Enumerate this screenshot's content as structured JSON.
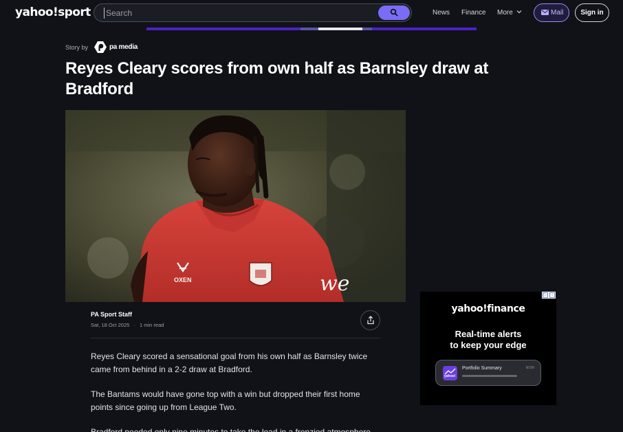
{
  "header": {
    "logo": "yahoo!sport",
    "search_placeholder": "Search",
    "nav": [
      "News",
      "Finance",
      "More"
    ],
    "mail_label": "Mail",
    "signin_label": "Sign in"
  },
  "article": {
    "story_by": "Story by",
    "publisher": "pa media",
    "headline": "Reyes Cleary scores from own half as Barnsley draw at Bradford",
    "author": "PA Sport Staff",
    "date": "Sat, 18 Oct 2025",
    "read_time": "1 min read",
    "paragraphs": [
      "Reyes Cleary scored a sensational goal from his own half as Barnsley twice came from behind in a 2-2 draw at Bradford.",
      "The Bantams would have gone top with a win but dropped their first home points since going up from League Two.",
      "Bradford needed only nine minutes to take the lead in a frenzied atmosphere"
    ]
  },
  "ad": {
    "logo": "yahoo!finance",
    "headline_line1": "Real-time alerts",
    "headline_line2": "to keep your edge",
    "card_title": "Portfolio Summary",
    "card_now": "NOW",
    "card_icon_text": "yahoo!"
  },
  "hero_shirt": {
    "sponsor": "OXEN",
    "script": "we"
  },
  "icons": [
    "search-icon",
    "chevron-down-icon",
    "mail-icon",
    "share-icon",
    "ad-choices-icon"
  ],
  "colors": {
    "accent": "#7b6cf6",
    "background": "#101218",
    "progress": "#4d21c7"
  }
}
